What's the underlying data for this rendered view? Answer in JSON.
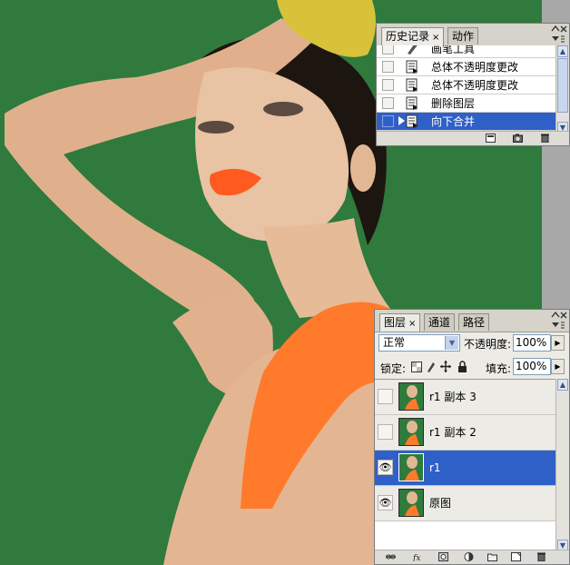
{
  "history_panel": {
    "tabs": [
      {
        "label": "历史记录",
        "close": "×"
      },
      {
        "label": "动作"
      }
    ],
    "items": [
      {
        "label": "画笔工具",
        "icon": "brush-icon"
      },
      {
        "label": "总体不透明度更改",
        "icon": "history-state-icon"
      },
      {
        "label": "总体不透明度更改",
        "icon": "history-state-icon"
      },
      {
        "label": "删除图层",
        "icon": "history-state-icon"
      },
      {
        "label": "向下合并",
        "icon": "history-state-icon",
        "selected": true
      }
    ],
    "footer_icons": [
      "new-document-from-state-icon",
      "snapshot-camera-icon",
      "trash-icon"
    ]
  },
  "layers_panel": {
    "tabs": [
      {
        "label": "图层",
        "close": "×"
      },
      {
        "label": "通道"
      },
      {
        "label": "路径"
      }
    ],
    "blend_mode": "正常",
    "opacity_label": "不透明度:",
    "opacity_value": "100%",
    "lock_label": "锁定:",
    "fill_label": "填充:",
    "fill_value": "100%",
    "layers": [
      {
        "name": "r1 副本 3",
        "visible": false,
        "selected": false
      },
      {
        "name": "r1 副本 2",
        "visible": false,
        "selected": false
      },
      {
        "name": "r1",
        "visible": true,
        "selected": true
      },
      {
        "name": "原图",
        "visible": true,
        "selected": false
      }
    ],
    "footer_icons": [
      "link-icon",
      "fx-icon",
      "mask-icon",
      "adjustment-layer-icon",
      "group-folder-icon",
      "new-layer-icon",
      "trash-icon"
    ]
  },
  "colors": {
    "canvas_background": "#2f7a3c",
    "selection": "#2f60c8",
    "lipstick": "#ff5a1f",
    "dress": "#ff7a2a",
    "glove": "#d7c23a"
  }
}
